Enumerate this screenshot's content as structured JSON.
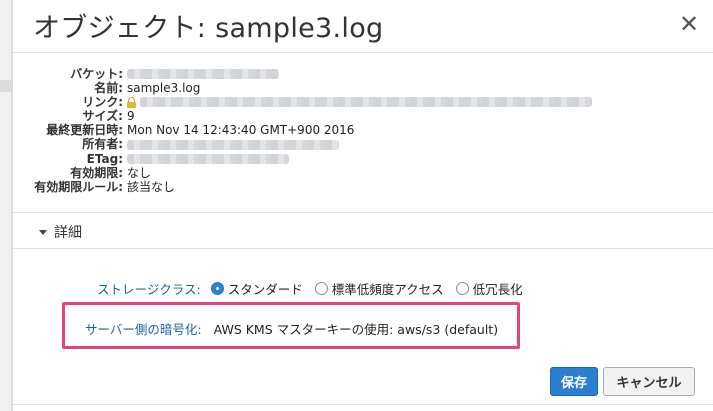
{
  "modal": {
    "title": "オブジェクト: sample3.log",
    "close_glyph": "✕"
  },
  "properties": [
    {
      "label": "バケット:",
      "value": ""
    },
    {
      "label": "名前:",
      "value": "sample3.log"
    },
    {
      "label": "リンク:",
      "value": ""
    },
    {
      "label": "サイズ:",
      "value": "9"
    },
    {
      "label": "最終更新日時:",
      "value": "Mon Nov 14 12:43:40 GMT+900 2016"
    },
    {
      "label": "所有者:",
      "value": ""
    },
    {
      "label": "ETag:",
      "value": ""
    },
    {
      "label": "有効期限:",
      "value": "なし"
    },
    {
      "label": "有効期限ルール:",
      "value": "該当なし"
    }
  ],
  "details": {
    "label": "詳細"
  },
  "storage_class": {
    "label": "ストレージクラス:",
    "options": [
      {
        "label": "スタンダード",
        "selected": true
      },
      {
        "label": "標準低頻度アクセス",
        "selected": false
      },
      {
        "label": "低冗長化",
        "selected": false
      }
    ]
  },
  "encryption": {
    "label": "サーバー側の暗号化:",
    "value": "AWS KMS マスターキーの使用: aws/s3 (default)",
    "highlight_color": "#e8417e"
  },
  "buttons": {
    "save": "保存",
    "cancel": "キャンセル",
    "primary_color": "#2a7fd1"
  }
}
